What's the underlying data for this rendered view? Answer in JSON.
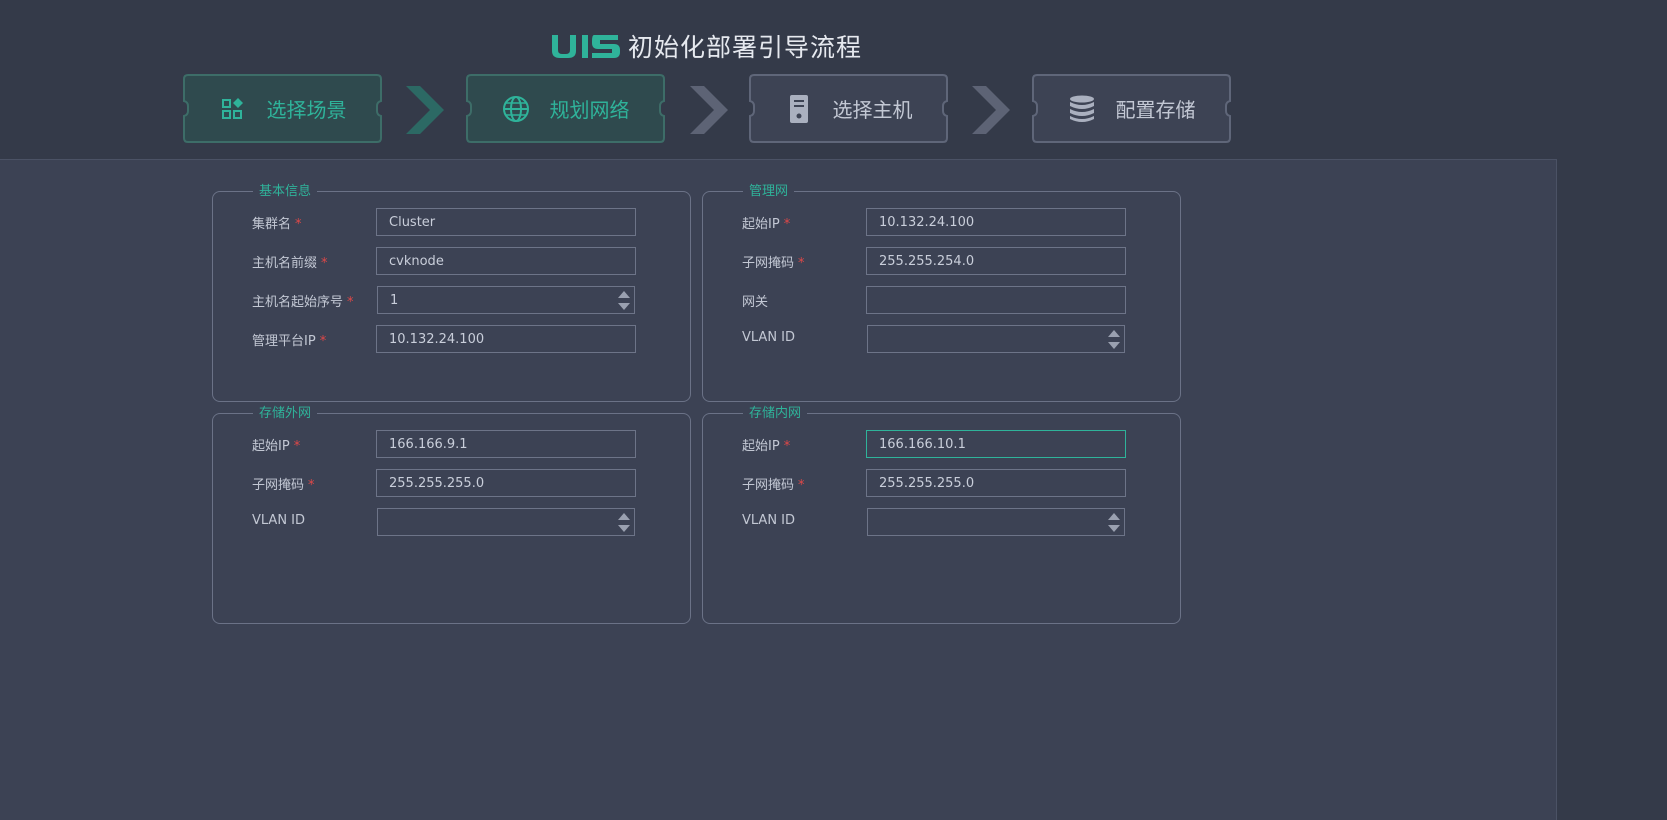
{
  "header": {
    "logo_text": "UIS",
    "title": "初始化部署引导流程"
  },
  "steps": [
    {
      "label": "选择场景",
      "icon": "apps-icon",
      "state": "done"
    },
    {
      "label": "规划网络",
      "icon": "globe-icon",
      "state": "done"
    },
    {
      "label": "选择主机",
      "icon": "server-icon",
      "state": "pending"
    },
    {
      "label": "配置存储",
      "icon": "database-icon",
      "state": "pending"
    }
  ],
  "colors": {
    "accent": "#2fb39a",
    "required": "#e04848",
    "background": "#3c4254",
    "header": "#343a49"
  },
  "basic": {
    "legend": "基本信息",
    "cluster_name_label": "集群名",
    "cluster_name_value": "Cluster",
    "host_prefix_label": "主机名前缀",
    "host_prefix_value": "cvknode",
    "host_start_label": "主机名起始序号",
    "host_start_value": "1",
    "mgmt_ip_label": "管理平台IP",
    "mgmt_ip_value": "10.132.24.100"
  },
  "mgmt_net": {
    "legend": "管理网",
    "start_ip_label": "起始IP",
    "start_ip_value": "10.132.24.100",
    "mask_label": "子网掩码",
    "mask_value": "255.255.254.0",
    "gateway_label": "网关",
    "gateway_value": "",
    "vlan_label": "VLAN ID",
    "vlan_value": ""
  },
  "storage_ext": {
    "legend": "存储外网",
    "start_ip_label": "起始IP",
    "start_ip_value": "166.166.9.1",
    "mask_label": "子网掩码",
    "mask_value": "255.255.255.0",
    "vlan_label": "VLAN ID",
    "vlan_value": ""
  },
  "storage_int": {
    "legend": "存储内网",
    "start_ip_label": "起始IP",
    "start_ip_value": "166.166.10.1",
    "mask_label": "子网掩码",
    "mask_value": "255.255.255.0",
    "vlan_label": "VLAN ID",
    "vlan_value": ""
  },
  "required_mark": "*"
}
